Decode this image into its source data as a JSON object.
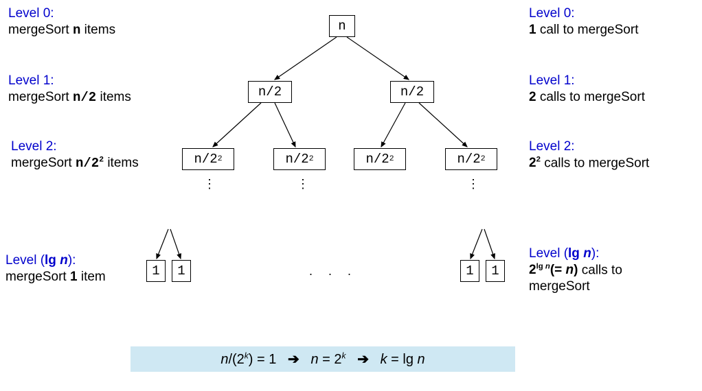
{
  "chart_data": {
    "type": "tree",
    "title": "mergeSort recursion tree",
    "levels": [
      {
        "level": 0,
        "items_per_call": "n",
        "num_calls": "1"
      },
      {
        "level": 1,
        "items_per_call": "n/2",
        "num_calls": "2"
      },
      {
        "level": 2,
        "items_per_call": "n/2^2",
        "num_calls": "2^2"
      },
      {
        "level": "lg n",
        "items_per_call": "1",
        "num_calls": "2^(lg n) = n"
      }
    ],
    "depth_formula": "n/(2^k) = 1  →  n = 2^k  →  k = lg n"
  },
  "left": {
    "l0a": "Level 0:",
    "l0b_pre": "mergeSort ",
    "l0b_code": "n",
    "l0b_post": " items",
    "l1a": "Level 1:",
    "l1b_pre": "mergeSort ",
    "l1b_code": "n/2",
    "l1b_post": " items",
    "l2a": "Level 2:",
    "l2b_pre": "mergeSort ",
    "l2b_code_base": "n/2",
    "l2b_post": " items",
    "lka_pre": "Level (",
    "lka_lg": "lg ",
    "lka_n": "n",
    "lka_post": "):",
    "lkb_pre": "mergeSort ",
    "lkb_num": "1",
    "lkb_post": " item"
  },
  "right": {
    "l0a": "Level 0:",
    "l0b_num": "1",
    "l0b_post": " call to mergeSort",
    "l1a": "Level 1:",
    "l1b_num": "2",
    "l1b_post": " calls to mergeSort",
    "l2a": "Level 2:",
    "l2b_base": "2",
    "l2b_post": " calls to mergeSort",
    "lka_pre": "Level (",
    "lka_lg": "lg ",
    "lka_n": "n",
    "lka_post": "):",
    "lkb_base": "2",
    "lkb_sup_pre": "lg ",
    "lkb_sup_n": "n",
    "lkb_mid": "(= ",
    "lkb_n2": "n",
    "lkb_close": ")",
    "lkb_post": " calls to",
    "lkb_line2": "mergeSort"
  },
  "nodes": {
    "n": "n",
    "n2": "n/2",
    "n22_base": "n/2",
    "one": "1"
  },
  "formula": {
    "a_n": "n",
    "a_mid": "/(2",
    "a_k": "k",
    "a_post": ") = 1",
    "arrow": "➔",
    "b_n": "n",
    "b_mid": " = 2",
    "b_k": "k",
    "c_k": "k",
    "c_mid": " = lg ",
    "c_n": "n"
  },
  "misc": {
    "two": "2",
    "vdots": "⋮",
    "hdots": ".   .   ."
  }
}
